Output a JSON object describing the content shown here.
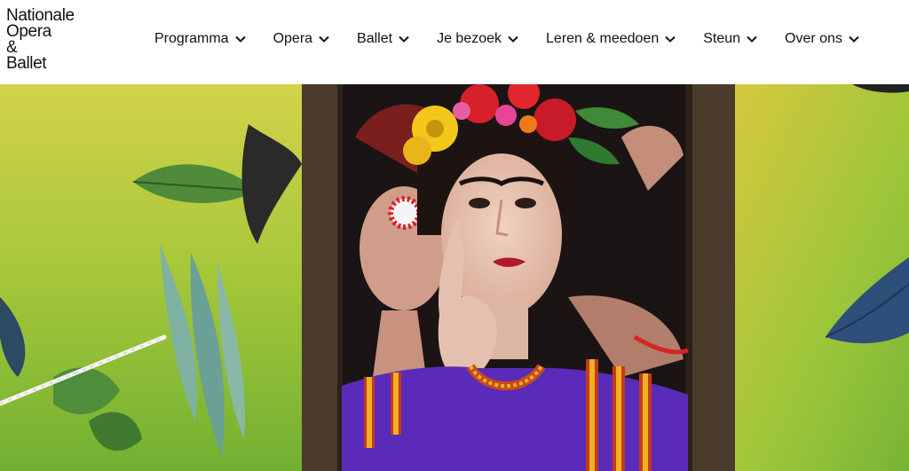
{
  "logo": {
    "lines": [
      "Nationale",
      "Opera",
      "&",
      "Ballet"
    ]
  },
  "nav": {
    "items": [
      {
        "label": "Programma"
      },
      {
        "label": "Opera"
      },
      {
        "label": "Ballet"
      },
      {
        "label": "Je bezoek"
      },
      {
        "label": "Leren & meedoen"
      },
      {
        "label": "Steun"
      },
      {
        "label": "Over ons"
      }
    ]
  },
  "hero": {
    "colors": {
      "wall": "#a9c93a",
      "frame": "#4a3a2c",
      "dress": "#5a2bb8",
      "flower_red": "#d8202b",
      "flower_yellow": "#f3c81a",
      "skin": "#e9c6b4"
    }
  }
}
